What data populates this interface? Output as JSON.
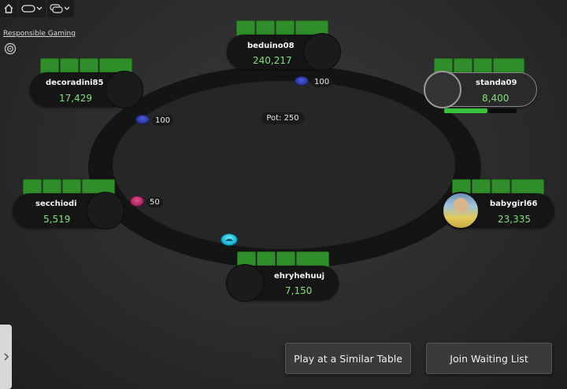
{
  "toolbar": {
    "home_icon": "home-icon",
    "table_view_icon": "table-view-icon",
    "multi_table_icon": "multi-table-icon"
  },
  "responsible_gaming": {
    "label": "Responsible Gaming",
    "icon": "target-icon"
  },
  "pot": {
    "label": "Pot: 250"
  },
  "players": [
    {
      "name": "beduino08",
      "stack": "240,217"
    },
    {
      "name": "standa09",
      "stack": "8,400"
    },
    {
      "name": "decoradini85",
      "stack": "17,429"
    },
    {
      "name": "secchiodi",
      "stack": "5,519"
    },
    {
      "name": "babygirl66",
      "stack": "23,335"
    },
    {
      "name": "ehryhehuuj",
      "stack": "7,150"
    }
  ],
  "bets": [
    {
      "amount": "100",
      "color": "#3340b8"
    },
    {
      "amount": "100",
      "color": "#3340b8"
    },
    {
      "amount": "50",
      "color": "#c8306f"
    }
  ],
  "timer": {
    "progress": 0.6
  },
  "buttons": {
    "similar_table": "Play at a Similar Table",
    "waiting_list": "Join Waiting List"
  },
  "colors": {
    "card_back": "#2f8d2a",
    "stack_text": "#7fe07a",
    "dealer_button": "#17b7d9"
  }
}
